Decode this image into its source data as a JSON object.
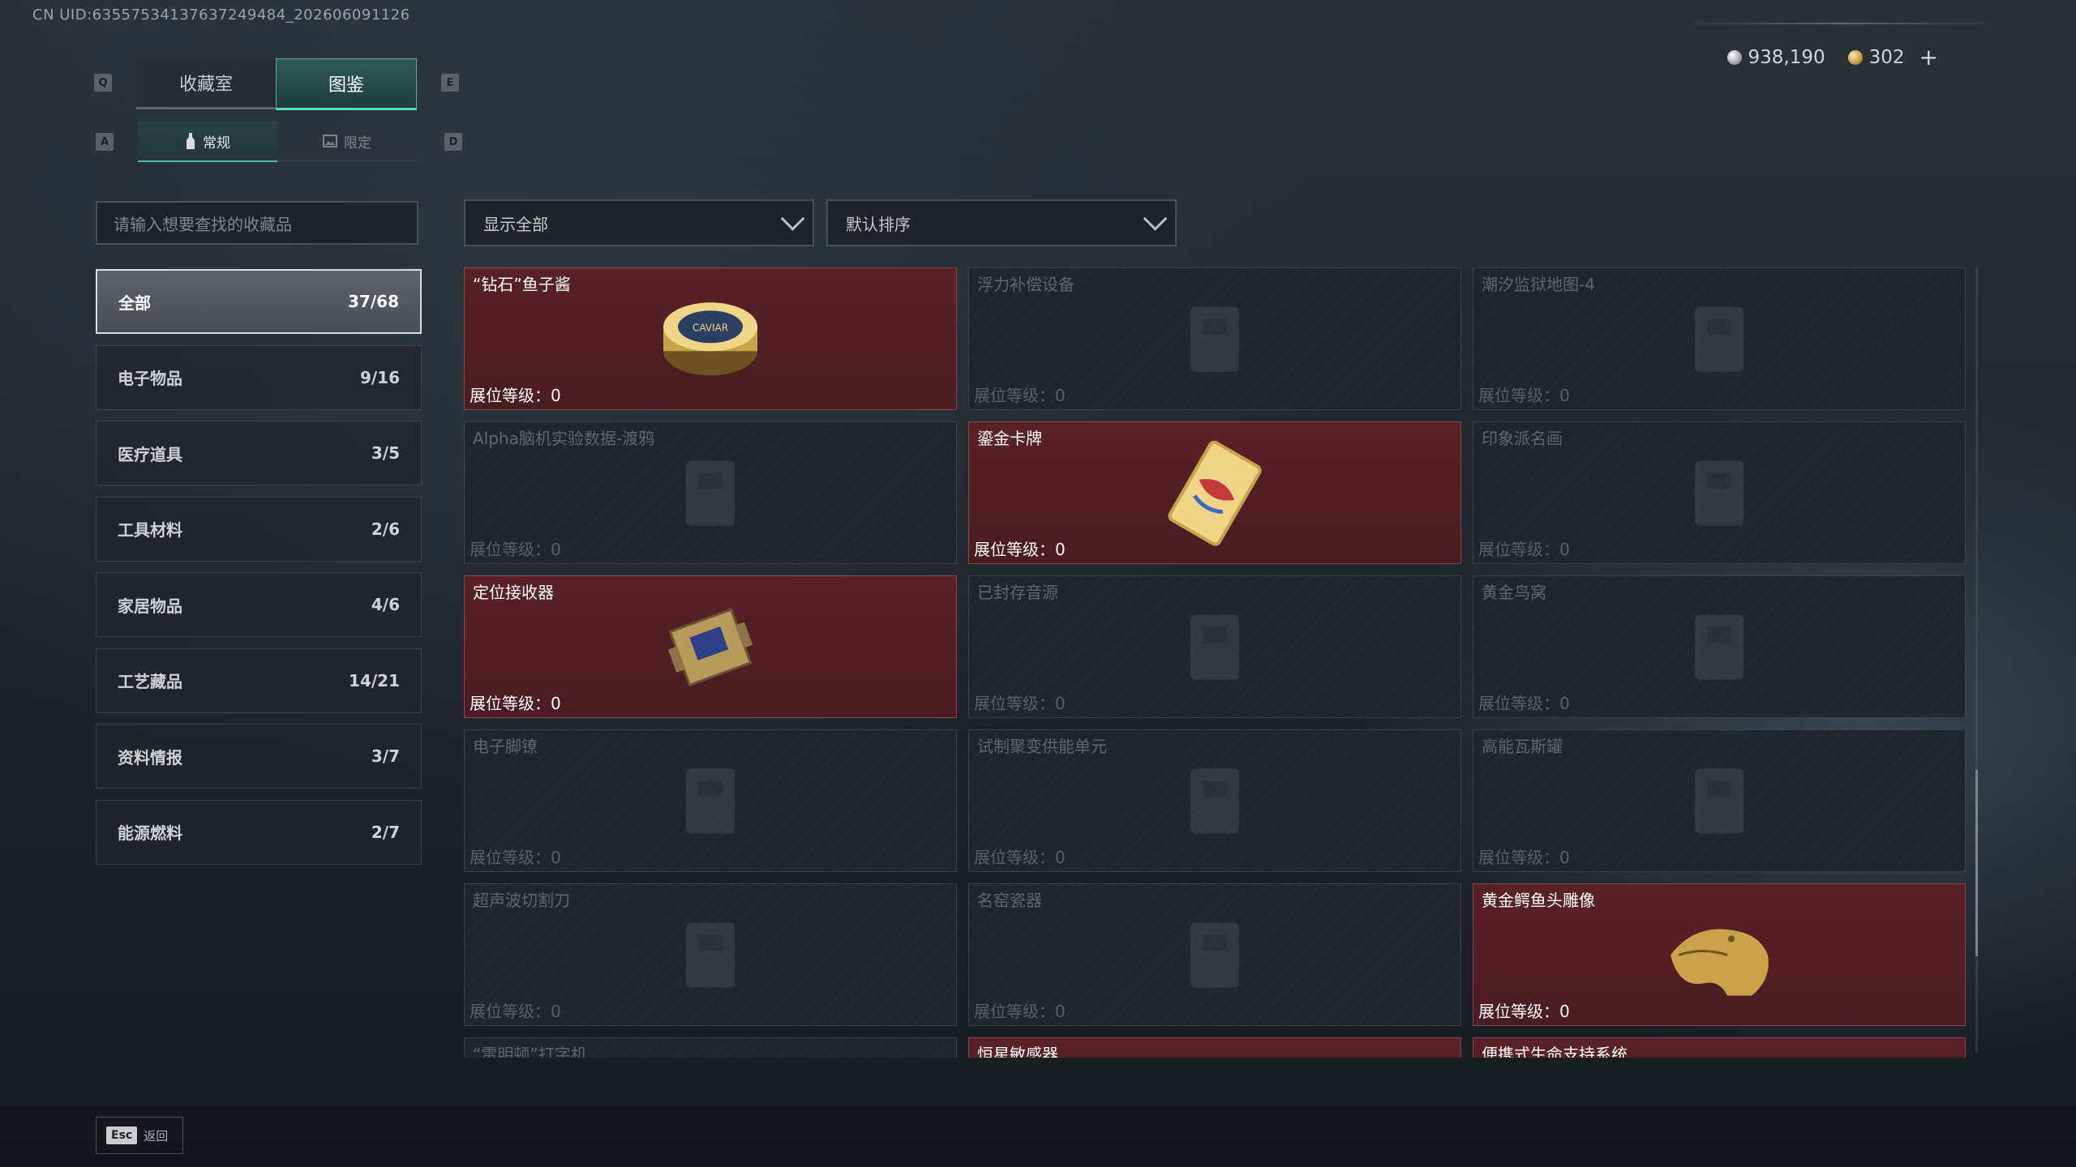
{
  "uid_text": "CN UID:6355753413763724948​4_202606091126",
  "currency": {
    "silver": "938,190",
    "gold": "302",
    "add_symbol": "+"
  },
  "tabs": {
    "prev_key": "Q",
    "next_key": "E",
    "collection_room": "收藏室",
    "codex": "图鉴",
    "active": "图鉴"
  },
  "subtabs": {
    "prev_key": "A",
    "next_key": "D",
    "regular": "常规",
    "limited": "限定",
    "active": "常规"
  },
  "search": {
    "placeholder": "请输入想要查找的收藏品"
  },
  "categories": [
    {
      "label": "全部",
      "count": "37/68",
      "active": true
    },
    {
      "label": "电子物品",
      "count": "9/16"
    },
    {
      "label": "医疗道具",
      "count": "3/5"
    },
    {
      "label": "工具材料",
      "count": "2/6"
    },
    {
      "label": "家居物品",
      "count": "4/6"
    },
    {
      "label": "工艺藏品",
      "count": "14/21"
    },
    {
      "label": "资料情报",
      "count": "3/7"
    },
    {
      "label": "能源燃料",
      "count": "2/7"
    }
  ],
  "filters": {
    "show": "显示全部",
    "sort": "默认排序"
  },
  "level_label": "展位等级：",
  "items": [
    {
      "name": "“钻石”鱼子酱",
      "level": "0",
      "owned": true,
      "icon": "caviar-tin-icon"
    },
    {
      "name": "浮力补偿设备",
      "level": "0",
      "owned": false,
      "icon": "buoyancy-device-icon"
    },
    {
      "name": "潮汐监狱地图-4",
      "level": "0",
      "owned": false,
      "icon": "map-icon"
    },
    {
      "name": "Alpha脑机实验数据-渡鸦",
      "level": "0",
      "owned": false,
      "icon": "data-drive-icon"
    },
    {
      "name": "鎏金卡牌",
      "level": "0",
      "owned": true,
      "icon": "gilded-card-icon"
    },
    {
      "name": "印象派名画",
      "level": "0",
      "owned": false,
      "icon": "painting-icon"
    },
    {
      "name": "定位接收器",
      "level": "0",
      "owned": true,
      "icon": "receiver-icon"
    },
    {
      "name": "已封存音源",
      "level": "0",
      "owned": false,
      "icon": "sound-source-icon"
    },
    {
      "name": "黄金鸟窝",
      "level": "0",
      "owned": false,
      "icon": "golden-nest-icon"
    },
    {
      "name": "电子脚镣",
      "level": "0",
      "owned": false,
      "icon": "ankle-monitor-icon"
    },
    {
      "name": "试制聚变供能单元",
      "level": "0",
      "owned": false,
      "icon": "fusion-unit-icon"
    },
    {
      "name": "高能瓦斯罐",
      "level": "0",
      "owned": false,
      "icon": "gas-canister-icon"
    },
    {
      "name": "超声波切割刀",
      "level": "0",
      "owned": false,
      "icon": "ultrasonic-knife-icon"
    },
    {
      "name": "名窑瓷器",
      "level": "0",
      "owned": false,
      "icon": "porcelain-vase-icon"
    },
    {
      "name": "黄金鳄鱼头雕像",
      "level": "0",
      "owned": true,
      "icon": "golden-crocodile-icon"
    },
    {
      "name": "“雷明顿”打字机",
      "level": "",
      "owned": false,
      "icon": "typewriter-icon"
    },
    {
      "name": "恒星敏感器",
      "level": "",
      "owned": true,
      "icon": "star-sensor-icon"
    },
    {
      "name": "便携式生命支持系统",
      "level": "",
      "owned": true,
      "icon": "life-support-icon"
    }
  ],
  "footer": {
    "esc_key": "Esc",
    "back_label": "返回"
  },
  "colors": {
    "accent": "#55e0b4",
    "owned_card": "#5a2128",
    "locked_card": "#1f262b"
  }
}
